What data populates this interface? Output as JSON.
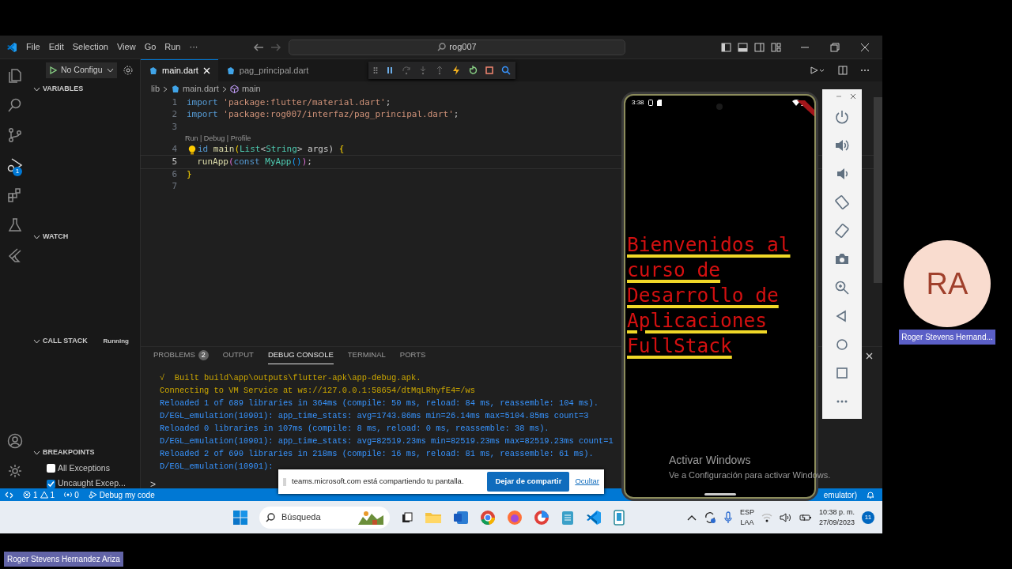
{
  "meeting": {
    "presenter_name": "Roger Stevens Hernandez Ariza",
    "participant": {
      "initials": "RA",
      "name": "Roger Stevens Hernand..."
    }
  },
  "vscode": {
    "menu": [
      "File",
      "Edit",
      "Selection",
      "View",
      "Go",
      "Run",
      "···"
    ],
    "command_center": "rog007",
    "run_config": "No Configu",
    "debug_badge": "1",
    "sections": [
      {
        "title": "VARIABLES",
        "expanded": true
      },
      {
        "title": "WATCH",
        "expanded": true
      },
      {
        "title": "CALL STACK",
        "expanded": true,
        "status": "Running"
      },
      {
        "title": "BREAKPOINTS",
        "expanded": true,
        "items": [
          {
            "label": "All Exceptions",
            "checked": false
          },
          {
            "label": "Uncaught Excep...",
            "checked": true
          }
        ]
      }
    ],
    "tabs": [
      {
        "label": "main.dart",
        "selected": true
      },
      {
        "label": "pag_principal.dart",
        "selected": false
      }
    ],
    "breadcrumb": [
      "lib",
      "main.dart",
      "main"
    ],
    "lines": [
      {
        "number": "1",
        "current": false,
        "tokens": [
          {
            "text": "import",
            "kind": "keyword"
          },
          {
            "text": " 'package:flutter/material.dart'",
            "kind": "string"
          },
          {
            "text": ";",
            "kind": "plain"
          }
        ]
      },
      {
        "number": "2",
        "current": false,
        "tokens": [
          {
            "text": "import",
            "kind": "keyword"
          },
          {
            "text": " 'package:rog007/interfaz/pag_principal.dart'",
            "kind": "string"
          },
          {
            "text": ";",
            "kind": "plain"
          }
        ]
      },
      {
        "number": "3",
        "current": false
      },
      {
        "number": "4",
        "current": false,
        "code_lens": "Run | Debug | Profile",
        "lightbulb": true,
        "tokens": [
          {
            "text": "id",
            "kind": "keyword"
          },
          {
            "text": " main",
            "kind": "function"
          },
          {
            "text": "(",
            "kind": "bracket"
          },
          {
            "text": "List",
            "kind": "type"
          },
          {
            "text": "<",
            "kind": "plain"
          },
          {
            "text": "String",
            "kind": "type"
          },
          {
            "text": "> args) ",
            "kind": "plain"
          },
          {
            "text": "{",
            "kind": "bracket"
          }
        ]
      },
      {
        "number": "5",
        "current": true,
        "tokens": [
          {
            "text": "  runApp",
            "kind": "function"
          },
          {
            "text": "(",
            "kind": "bracket2"
          },
          {
            "text": "const",
            "kind": "keyword"
          },
          {
            "text": " MyApp",
            "kind": "type"
          },
          {
            "text": "()",
            "kind": "bracket3"
          },
          {
            "text": ")",
            "kind": "bracket2"
          },
          {
            "text": ";",
            "kind": "plain"
          }
        ]
      },
      {
        "number": "6",
        "current": false,
        "tokens": [
          {
            "text": "}",
            "kind": "bracket"
          }
        ]
      },
      {
        "number": "7",
        "current": false
      }
    ],
    "panel_tabs": [
      {
        "label": "PROBLEMS",
        "badge": "2",
        "selected": false
      },
      {
        "label": "OUTPUT",
        "selected": false
      },
      {
        "label": "DEBUG CONSOLE",
        "selected": true
      },
      {
        "label": "TERMINAL",
        "selected": false
      },
      {
        "label": "PORTS",
        "selected": false
      }
    ],
    "console": [
      {
        "text": "√  Built build\\app\\outputs\\flutter-apk\\app-debug.apk.",
        "kind": "status"
      },
      {
        "text": "Connecting to VM Service at ws://127.0.0.1:58654/dtMqLRhyfE4=/ws",
        "kind": "status"
      },
      {
        "text": "Reloaded 1 of 689 libraries in 364ms (compile: 50 ms, reload: 84 ms, reassemble: 104 ms).",
        "kind": "log"
      },
      {
        "text": "D/EGL_emulation(10901): app_time_stats: avg=1743.86ms min=26.14ms max=5104.85ms count=3",
        "kind": "log"
      },
      {
        "text": "Reloaded 0 libraries in 107ms (compile: 8 ms, reload: 0 ms, reassemble: 38 ms).",
        "kind": "log"
      },
      {
        "text": "D/EGL_emulation(10901): app_time_stats: avg=82519.23ms min=82519.23ms max=82519.23ms count=1",
        "kind": "log"
      },
      {
        "text": "Reloaded 2 of 690 libraries in 218ms (compile: 16 ms, reload: 81 ms, reassemble: 61 ms).",
        "kind": "log"
      },
      {
        "text": "D/EGL_emulation(10901):",
        "kind": "log"
      }
    ],
    "prompt": ">",
    "status_bar": {
      "errors": "1",
      "warnings": "1",
      "ports": "0",
      "debug_label": "Debug my code",
      "right_text": "emulator)"
    }
  },
  "teams_share_bar": {
    "message": "teams.microsoft.com está compartiendo tu pantalla.",
    "stop_button": "Dejar de compartir",
    "hide_link": "Ocultar"
  },
  "emulator": {
    "clock": "3:38",
    "message": "Bienvenidos al curso de Desarrollo de Aplicaciones FullStack"
  },
  "windows_activation": {
    "title": "Activar Windows",
    "subtitle": "Ve a Configuración para activar Windows."
  },
  "taskbar": {
    "search_placeholder": "Búsqueda",
    "language": "ESP",
    "layout": "LAA",
    "time": "10:38 p. m.",
    "date": "27/09/2023",
    "notification_count": "11"
  }
}
